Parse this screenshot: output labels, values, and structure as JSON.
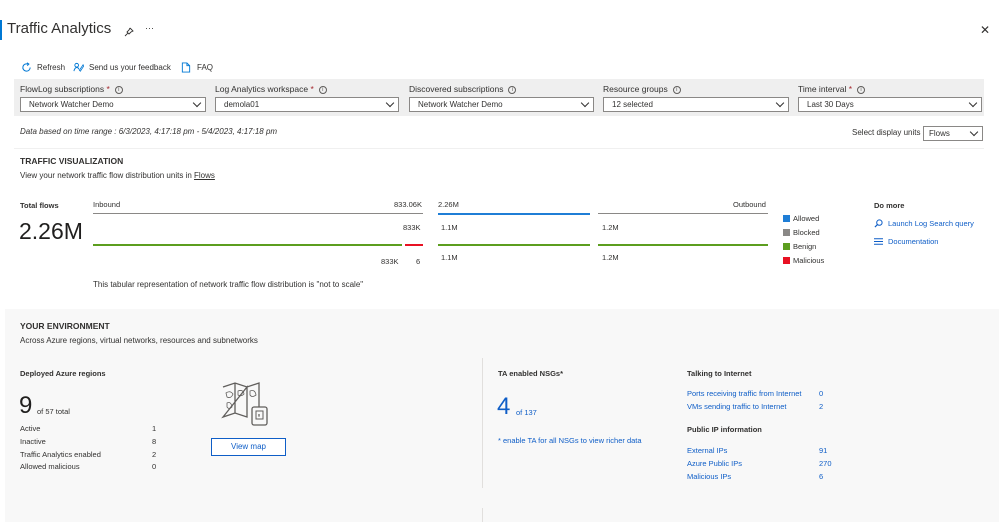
{
  "header": {
    "title": "Traffic Analytics",
    "more": "···",
    "close": "✕"
  },
  "toolbar": {
    "refresh": "Refresh",
    "feedback": "Send us your feedback",
    "faq": "FAQ"
  },
  "filters": [
    {
      "label": "FlowLog subscriptions",
      "required": true,
      "value": "Network Watcher Demo"
    },
    {
      "label": "Log Analytics workspace",
      "required": true,
      "value": "demola01"
    },
    {
      "label": "Discovered subscriptions",
      "required": false,
      "value": "Network Watcher Demo"
    },
    {
      "label": "Resource groups",
      "required": false,
      "value": "12 selected"
    },
    {
      "label": "Time interval",
      "required": true,
      "value": "Last 30 Days"
    }
  ],
  "time_range_text": "Data based on time range : 6/3/2023, 4:17:18 pm - 5/4/2023, 4:17:18 pm",
  "display_units": {
    "label": "Select display units",
    "value": "Flows"
  },
  "traffic": {
    "heading": "TRAFFIC VISUALIZATION",
    "desc_prefix": "View your network traffic flow distribution units in",
    "desc_link": "Flows",
    "total_label": "Total flows",
    "total_value": "2.26M",
    "inbound_label": "Inbound",
    "inbound_total": "833.06K",
    "inbound_row1": "833K",
    "inbound_row2a": "833K",
    "inbound_row2b": "6",
    "center_total": "2.26M",
    "center_row1": "1.1M",
    "center_row2": "1.1M",
    "outbound_label": "Outbound",
    "outbound_row1": "1.2M",
    "outbound_row2": "1.2M",
    "note": "This tabular representation of network traffic flow distribution is \"not to scale\"",
    "legend": [
      {
        "label": "Allowed",
        "color": "#1f7ed6"
      },
      {
        "label": "Blocked",
        "color": "#8a8886"
      },
      {
        "label": "Benign",
        "color": "#5c9e1f"
      },
      {
        "label": "Malicious",
        "color": "#e81123"
      }
    ],
    "do_more_heading": "Do more",
    "do_more_links": [
      "Launch Log Search query",
      "Documentation"
    ]
  },
  "environment": {
    "heading": "YOUR ENVIRONMENT",
    "desc": "Across Azure regions, virtual networks, resources and subnetworks",
    "regions_heading": "Deployed Azure regions",
    "regions_count": "9",
    "regions_of": "of 57 total",
    "regions_stats": [
      {
        "label": "Active",
        "value": "1"
      },
      {
        "label": "Inactive",
        "value": "8"
      },
      {
        "label": "Traffic Analytics enabled",
        "value": "2"
      },
      {
        "label": "Allowed malicious",
        "value": "0"
      }
    ],
    "view_map": "View map",
    "nsg_heading": "TA enabled NSGs*",
    "nsg_count": "4",
    "nsg_of": "of 137",
    "nsg_note": "* enable TA for all NSGs to view richer data",
    "internet_heading": "Talking to Internet",
    "internet_rows": [
      {
        "label": "Ports receiving traffic from Internet",
        "value": "0"
      },
      {
        "label": "VMs sending traffic to Internet",
        "value": "2"
      }
    ],
    "public_ip_heading": "Public IP information",
    "public_ip_rows": [
      {
        "label": "External IPs",
        "value": "91"
      },
      {
        "label": "Azure Public IPs",
        "value": "270"
      },
      {
        "label": "Malicious IPs",
        "value": "6"
      }
    ]
  }
}
